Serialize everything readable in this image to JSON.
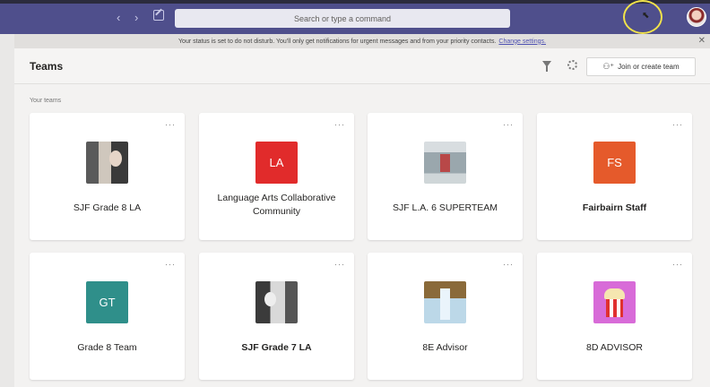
{
  "topbar": {
    "search_placeholder": "Search or type a command",
    "back_icon": "chevron-left-icon",
    "forward_icon": "chevron-right-icon",
    "compose_icon": "compose-icon",
    "back_glyph": "‹",
    "forward_glyph": "›",
    "cursor_glyph": "⬉"
  },
  "status_bar": {
    "message": "Your status is set to do not disturb. You'll only get notifications for urgent messages and from your priority contacts.",
    "link": "Change settings.",
    "close_glyph": "✕"
  },
  "header": {
    "title": "Teams",
    "join_button": "Join or create team",
    "join_glyph": "⚇⁺"
  },
  "section_label": "Your teams",
  "more_glyph": "···",
  "teams": [
    {
      "name": "SJF Grade 8 LA",
      "tile": "photo",
      "bold": false
    },
    {
      "name": "Language Arts Collaborative Community",
      "tile": "LA",
      "color": "#e12b2b",
      "bold": false
    },
    {
      "name": "SJF L.A. 6 SUPERTEAM",
      "tile": "photo",
      "bold": false
    },
    {
      "name": "Fairbairn Staff",
      "tile": "FS",
      "color": "#e55a2b",
      "bold": true
    },
    {
      "name": "Grade 8 Team",
      "tile": "GT",
      "color": "#2f8f8a",
      "bold": false
    },
    {
      "name": "SJF Grade 7 LA",
      "tile": "photo",
      "bold": true
    },
    {
      "name": "8E Advisor",
      "tile": "photo",
      "bold": false
    },
    {
      "name": "8D ADVISOR",
      "tile": "photo",
      "bold": false
    }
  ]
}
